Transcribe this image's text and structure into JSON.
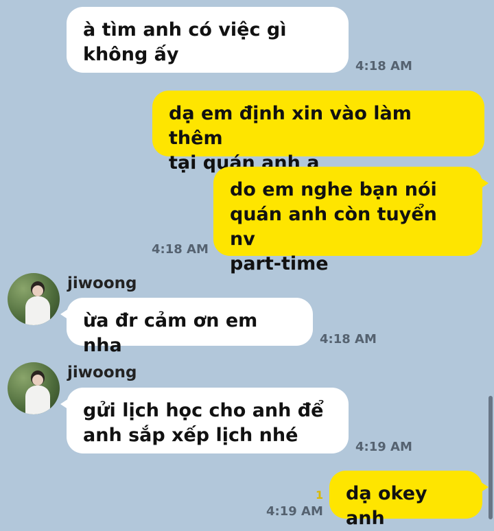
{
  "messages": [
    {
      "text": "à tìm anh có việc gì\nkhông ấy",
      "time": "4:18 AM"
    },
    {
      "text": "dạ em định xin vào làm thêm\ntại quán anh ạ"
    },
    {
      "text": "do em nghe bạn nói\nquán anh còn tuyển nv\npart-time",
      "time": "4:18 AM"
    },
    {
      "sender": "jiwoong",
      "text": "ừa đr cảm ơn em nha",
      "time": "4:18 AM"
    },
    {
      "sender": "jiwoong",
      "text": "gửi lịch học cho anh để\nanh sắp xếp lịch nhé",
      "time": "4:19 AM"
    },
    {
      "text": "dạ okey anh",
      "time": "4:19 AM",
      "unread": "1"
    }
  ],
  "colors": {
    "background": "#b2c7da",
    "incoming_bubble": "#ffffff",
    "outgoing_bubble": "#fee500"
  },
  "icons": [
    "avatar",
    "scrollbar"
  ]
}
